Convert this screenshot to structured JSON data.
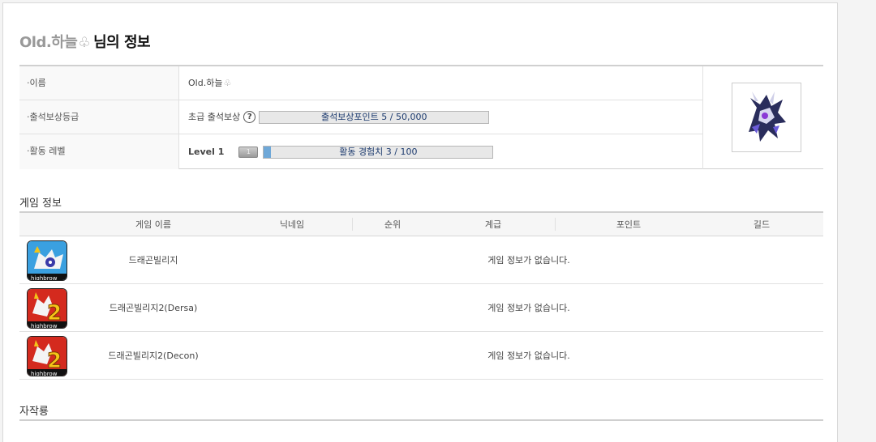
{
  "profile": {
    "nickname": "Old.하늘",
    "title_suffix": "님의 정보"
  },
  "info": {
    "rows": [
      {
        "key": "·이름",
        "value": "Old.하늘"
      },
      {
        "key": "·출석보상등급",
        "grade": "초급 출석보상",
        "bar_text": "출석보상포인트 5 / 50,000",
        "progress": 0.0001
      },
      {
        "key": "·활동 레벨",
        "level": "Level 1",
        "badge": "1",
        "bar_text": "활동 경험치 3 / 100",
        "progress": 0.03
      }
    ],
    "help_icon": "question-circle-icon",
    "avatar": "dragon-character-avatar"
  },
  "games": {
    "section_title": "게임 정보",
    "columns": [
      "게임 이름",
      "닉네임",
      "순위",
      "계급",
      "포인트",
      "길드"
    ],
    "rows": [
      {
        "name": "드래곤빌리지",
        "message": "게임 정보가 없습니다.",
        "icon": "dragon-village-icon"
      },
      {
        "name": "드래곤빌리지2(Dersa)",
        "message": "게임 정보가 없습니다.",
        "icon": "dragon-village-2-icon"
      },
      {
        "name": "드래곤빌리지2(Decon)",
        "message": "게임 정보가 없습니다.",
        "icon": "dragon-village-2-icon"
      }
    ]
  },
  "craft": {
    "section_title": "자작룡"
  },
  "colors": {
    "accent_bar": "#6fa8d8",
    "bar_text": "#1c3a6e",
    "border": "#d0d0d0"
  }
}
